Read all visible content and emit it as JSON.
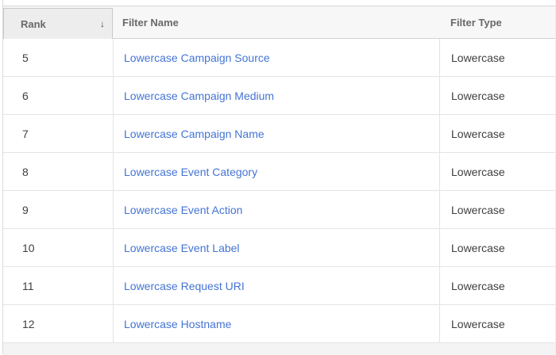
{
  "header": {
    "columns": [
      {
        "label": "Rank",
        "sorted": true
      },
      {
        "label": "Filter Name",
        "sorted": false
      },
      {
        "label": "Filter Type",
        "sorted": false
      }
    ],
    "sort_icon": "↓",
    "sort_direction": "descending"
  },
  "table": {
    "rows": [
      {
        "rank": "5",
        "name": "Lowercase Campaign Source",
        "type": "Lowercase"
      },
      {
        "rank": "6",
        "name": "Lowercase Campaign Medium",
        "type": "Lowercase"
      },
      {
        "rank": "7",
        "name": "Lowercase Campaign Name",
        "type": "Lowercase"
      },
      {
        "rank": "8",
        "name": "Lowercase Event Category",
        "type": "Lowercase"
      },
      {
        "rank": "9",
        "name": "Lowercase Event Action",
        "type": "Lowercase"
      },
      {
        "rank": "10",
        "name": "Lowercase Event Label",
        "type": "Lowercase"
      },
      {
        "rank": "11",
        "name": "Lowercase Request URI",
        "type": "Lowercase"
      },
      {
        "rank": "12",
        "name": "Lowercase Hostname",
        "type": "Lowercase"
      }
    ]
  },
  "colors": {
    "link_blue": "#4474d4",
    "header_bg": "#f7f7f7",
    "sorted_header_bg": "#ededed",
    "table_border": "#d6d6d6",
    "panel_border": "#dadada",
    "row_border": "#e4e4e4",
    "footer_bg": "#f4f4f4"
  }
}
